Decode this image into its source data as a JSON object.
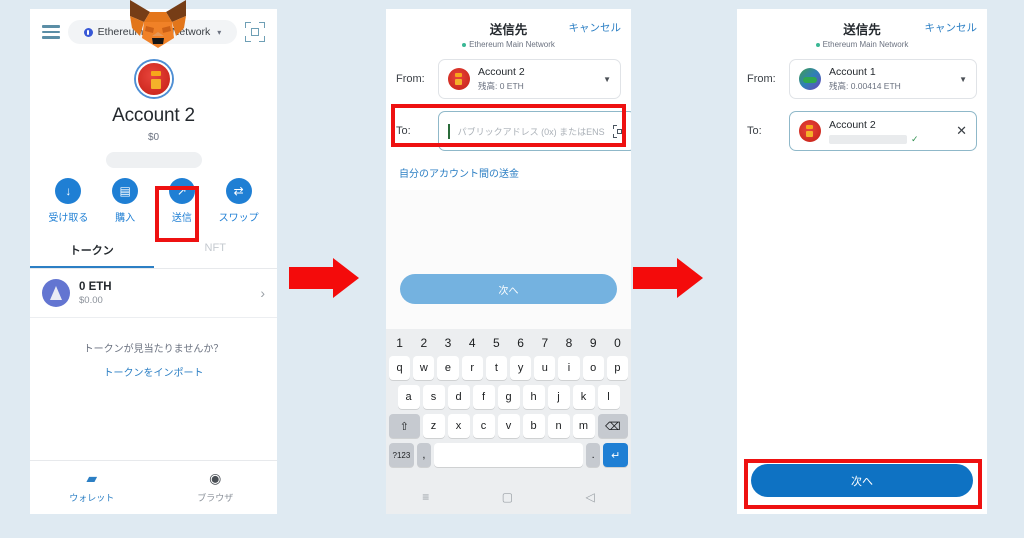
{
  "background_color": "#dfeaf2",
  "accent_blue": "#1f7fd4",
  "highlight_red": "#ee1111",
  "panel1": {
    "name": "metamask-wallet-home",
    "topbar": {
      "menu_icon": "hamburger-icon",
      "network_label": "Ethereum Main Network",
      "network_chevron": "▾",
      "scan_icon": "qr-scan-icon",
      "brand_logo": "metamask-fox-logo"
    },
    "account": {
      "avatar": "account-avatar-red",
      "name": "Account 2",
      "fiat_balance": "$0",
      "address_redacted": true
    },
    "actions": [
      {
        "glyph": "↓",
        "label": "受け取る",
        "name": "receive"
      },
      {
        "glyph": "▤",
        "label": "購入",
        "name": "buy"
      },
      {
        "glyph": "↗",
        "label": "送信",
        "name": "send"
      },
      {
        "glyph": "⇄",
        "label": "スワップ",
        "name": "swap"
      }
    ],
    "tabs": [
      {
        "label": "トークン",
        "active": true
      },
      {
        "label": "NFT",
        "active": false
      }
    ],
    "token_row": {
      "icon": "ethereum-icon",
      "amount": "0 ETH",
      "fiat": "$0.00",
      "chevron": "›"
    },
    "empty_state": {
      "question": "トークンが見当たりませんか？",
      "action": "トークンをインポート"
    },
    "bottom_nav": [
      {
        "glyph": "▰",
        "label": "ウォレット",
        "active": true
      },
      {
        "glyph": "◉",
        "label": "ブラウザ",
        "active": false
      }
    ]
  },
  "panel2": {
    "name": "send-to-screen-empty",
    "header": {
      "title": "送信先",
      "network": "Ethereum Main Network",
      "cancel": "キャンセル"
    },
    "from": {
      "label": "From:",
      "avatar": "account-avatar-red",
      "account": "Account 2",
      "balance": "残高: 0 ETH",
      "caret": "▼"
    },
    "to": {
      "label": "To:",
      "placeholder": "パブリックアドレス (0x) またはENS",
      "scan_icon": "qr-scan-icon"
    },
    "own_accounts_link": "自分のアカウント間の送金",
    "next_button": "次へ",
    "keyboard": {
      "row_numbers": [
        "1",
        "2",
        "3",
        "4",
        "5",
        "6",
        "7",
        "8",
        "9",
        "0"
      ],
      "row1": [
        "q",
        "w",
        "e",
        "r",
        "t",
        "y",
        "u",
        "i",
        "o",
        "p"
      ],
      "row2": [
        "a",
        "s",
        "d",
        "f",
        "g",
        "h",
        "j",
        "k",
        "l"
      ],
      "row3_shift": "⇧",
      "row3": [
        "z",
        "x",
        "c",
        "v",
        "b",
        "n",
        "m"
      ],
      "row3_backspace": "⌫",
      "row4_symbols": "?123",
      "row4_comma": ",",
      "row4_space": "",
      "row4_period": ".",
      "row4_enter": "↵"
    },
    "nav_bar": [
      "≡",
      "▢",
      "◁"
    ]
  },
  "panel3": {
    "name": "send-to-screen-filled",
    "header": {
      "title": "送信先",
      "network": "Ethereum Main Network",
      "cancel": "キャンセル"
    },
    "from": {
      "label": "From:",
      "avatar": "account-avatar-green",
      "account": "Account 1",
      "balance": "残高: 0.00414 ETH",
      "caret": "▼"
    },
    "to": {
      "label": "To:",
      "avatar": "account-avatar-red",
      "account": "Account 2",
      "address_redacted": true,
      "valid_check": "✓",
      "clear": "✕"
    },
    "next_button": "次へ"
  }
}
